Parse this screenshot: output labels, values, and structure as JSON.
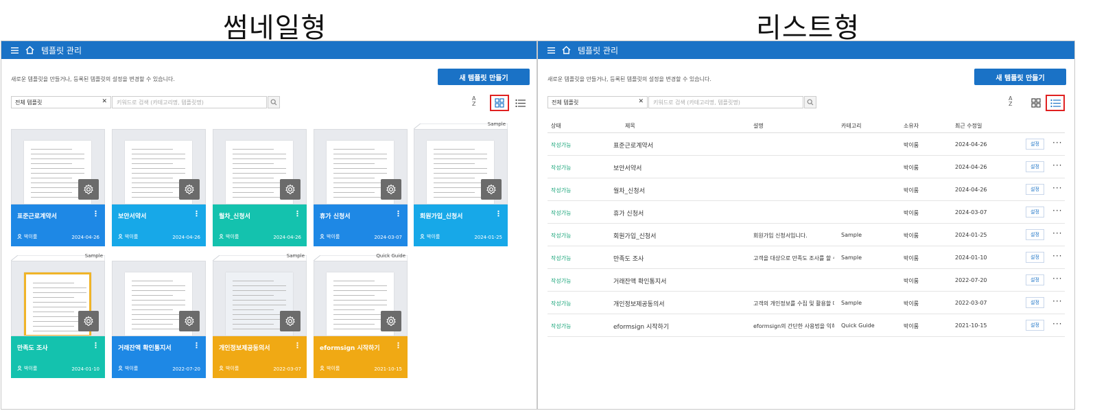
{
  "labels": {
    "thumbnail_view": "썸네일형",
    "list_view": "리스트형"
  },
  "app": {
    "title": "템플릿 관리",
    "description": "새로운 템플릿을 만들거나, 등록된 템플릿의 설정을 변경할 수 있습니다.",
    "new_button": "새 템플릿 만들기",
    "filter_value": "전체 템플릿",
    "filter_clear": "✕",
    "search_placeholder": "키워드로 검색 (카테고리명, 템플릿명)",
    "sort_label_a": "A",
    "sort_label_z": "Z"
  },
  "colors": {
    "header_blue": "#1a72c6",
    "card_blue": "#1e88e5",
    "card_sky": "#17a8e8",
    "card_teal": "#14c2ae",
    "card_gold": "#f0a914",
    "status_green": "#1aa57a",
    "highlight_red": "#e02020"
  },
  "cards": [
    {
      "name": "표준근로계약서",
      "owner": "박이룸",
      "date": "2024-04-26",
      "color": "#1e88e5",
      "tag": ""
    },
    {
      "name": "보안서약서",
      "owner": "박이룸",
      "date": "2024-04-26",
      "color": "#17a8e8",
      "tag": ""
    },
    {
      "name": "월차_신청서",
      "owner": "박이룸",
      "date": "2024-04-26",
      "color": "#14c2ae",
      "tag": ""
    },
    {
      "name": "휴가 신청서",
      "owner": "박이룸",
      "date": "2024-03-07",
      "color": "#1e88e5",
      "tag": ""
    },
    {
      "name": "회원가입_신청서",
      "owner": "박이룸",
      "date": "2024-01-25",
      "color": "#17a8e8",
      "tag": "Sample"
    },
    {
      "name": "만족도 조사",
      "owner": "박이룸",
      "date": "2024-01-10",
      "color": "#14c2ae",
      "tag": "Sample"
    },
    {
      "name": "거래잔액 확인통지서",
      "owner": "박이룸",
      "date": "2022-07-20",
      "color": "#1e88e5",
      "tag": ""
    },
    {
      "name": "개인정보제공동의서",
      "owner": "박이룸",
      "date": "2022-03-07",
      "color": "#f0a914",
      "tag": "Sample"
    },
    {
      "name": "eformsign 시작하기",
      "owner": "박이룸",
      "date": "2021-10-15",
      "color": "#f0a914",
      "tag": "Quick Guide"
    }
  ],
  "list": {
    "headers": {
      "status": "상태",
      "title": "제목",
      "desc": "설명",
      "category": "카테고리",
      "owner": "소유자",
      "modified": "최근 수정일"
    },
    "set_label": "설정",
    "more_label": "···",
    "rows": [
      {
        "status": "작성가능",
        "title": "표준근로계약서",
        "desc": "",
        "category": "",
        "owner": "박이룸",
        "date": "2024-04-26"
      },
      {
        "status": "작성가능",
        "title": "보안서약서",
        "desc": "",
        "category": "",
        "owner": "박이룸",
        "date": "2024-04-26"
      },
      {
        "status": "작성가능",
        "title": "월차_신청서",
        "desc": "",
        "category": "",
        "owner": "박이룸",
        "date": "2024-04-26"
      },
      {
        "status": "작성가능",
        "title": "휴가 신청서",
        "desc": "",
        "category": "",
        "owner": "박이룸",
        "date": "2024-03-07"
      },
      {
        "status": "작성가능",
        "title": "회원가입_신청서",
        "desc": "회원가입 신청서입니다.",
        "category": "Sample",
        "owner": "박이룸",
        "date": "2024-01-25"
      },
      {
        "status": "작성가능",
        "title": "만족도 조사",
        "desc": "고객을 대상으로 만족도 조사를 할 수 …",
        "category": "Sample",
        "owner": "박이룸",
        "date": "2024-01-10"
      },
      {
        "status": "작성가능",
        "title": "거래잔액 확인통지서",
        "desc": "",
        "category": "",
        "owner": "박이룸",
        "date": "2022-07-20"
      },
      {
        "status": "작성가능",
        "title": "개인정보제공동의서",
        "desc": "고객의 개인정보를 수집 및 활용할 때 …",
        "category": "Sample",
        "owner": "박이룸",
        "date": "2022-03-07"
      },
      {
        "status": "작성가능",
        "title": "eformsign 시작하기",
        "desc": "eformsign의 간단한 사용법을 익혀 …",
        "category": "Quick Guide",
        "owner": "박이룸",
        "date": "2021-10-15"
      }
    ]
  }
}
